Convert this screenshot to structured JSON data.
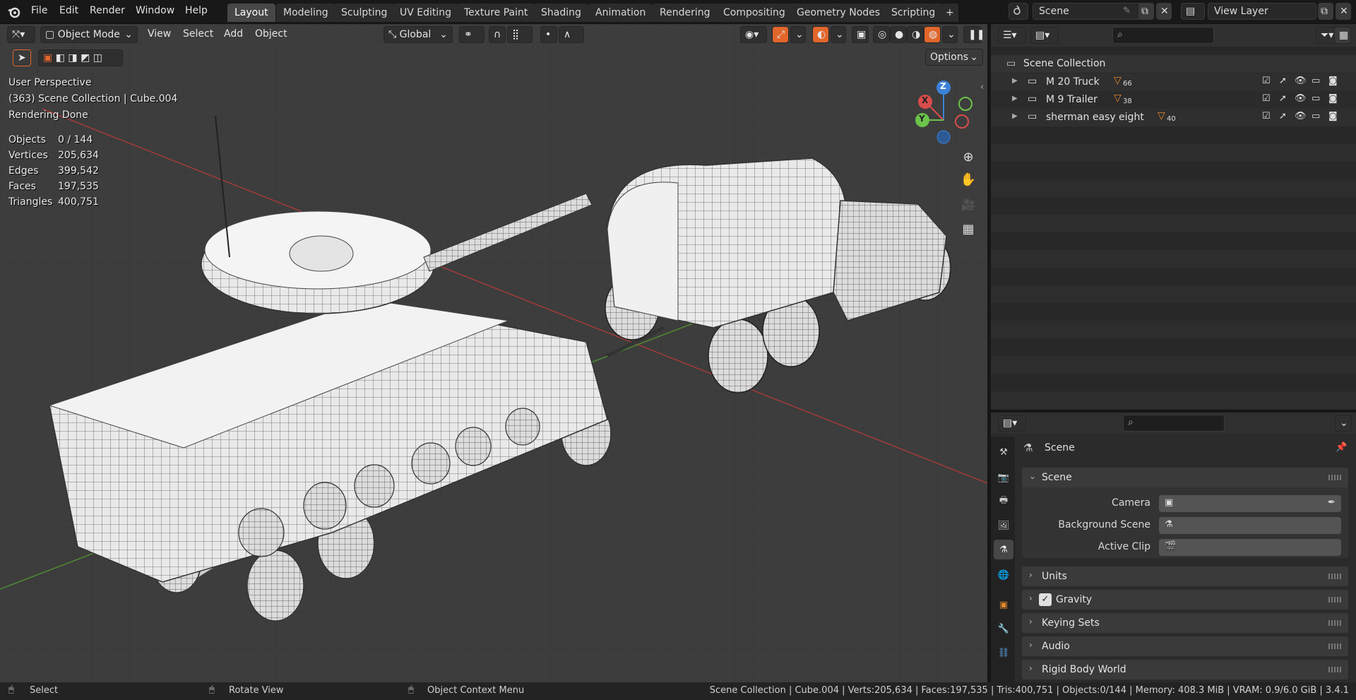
{
  "topbar": {
    "menus": [
      "File",
      "Edit",
      "Render",
      "Window",
      "Help"
    ],
    "workspaces": [
      "Layout",
      "Modeling",
      "Sculpting",
      "UV Editing",
      "Texture Paint",
      "Shading",
      "Animation",
      "Rendering",
      "Compositing",
      "Geometry Nodes",
      "Scripting"
    ],
    "active_workspace": "Layout",
    "scene_name": "Scene",
    "view_layer": "View Layer"
  },
  "viewport": {
    "mode": "Object Mode",
    "menus": [
      "View",
      "Select",
      "Add",
      "Object"
    ],
    "transform_orientation": "Global",
    "options_label": "Options",
    "perspective": "User Perspective",
    "collection_info": "(363) Scene Collection | Cube.004",
    "render_status": "Rendering Done",
    "stats": [
      {
        "label": "Objects",
        "value": "0 / 144"
      },
      {
        "label": "Vertices",
        "value": "205,634"
      },
      {
        "label": "Edges",
        "value": "399,542"
      },
      {
        "label": "Faces",
        "value": "197,535"
      },
      {
        "label": "Triangles",
        "value": "400,751"
      }
    ],
    "gizmo": {
      "z": "Z",
      "x": "X",
      "y": "Y"
    }
  },
  "outliner": {
    "root": "Scene Collection",
    "collections": [
      {
        "name": "M 20 Truck",
        "count": "66"
      },
      {
        "name": "M 9 Trailer",
        "count": "38"
      },
      {
        "name": "sherman easy eight",
        "count": "40"
      }
    ]
  },
  "properties": {
    "context_title": "Scene",
    "panel_scene": "Scene",
    "camera_label": "Camera",
    "background_scene_label": "Background Scene",
    "active_clip_label": "Active Clip",
    "panels": [
      "Units",
      "Gravity",
      "Keying Sets",
      "Audio",
      "Rigid Body World"
    ],
    "gravity_enabled": true
  },
  "statusbar": {
    "select": "Select",
    "rotate": "Rotate View",
    "context_menu": "Object Context Menu",
    "info": "Scene Collection | Cube.004 | Verts:205,634 | Faces:197,535 | Tris:400,751 | Objects:0/144 | Memory: 408.3 MiB | VRAM: 0.9/6.0 GiB | 3.4.1"
  },
  "colors": {
    "accent": "#e2662b",
    "x_axis": "#d94c4c",
    "y_axis": "#6cc24a",
    "z_axis": "#3c82d8",
    "active_tab": "#474747"
  }
}
